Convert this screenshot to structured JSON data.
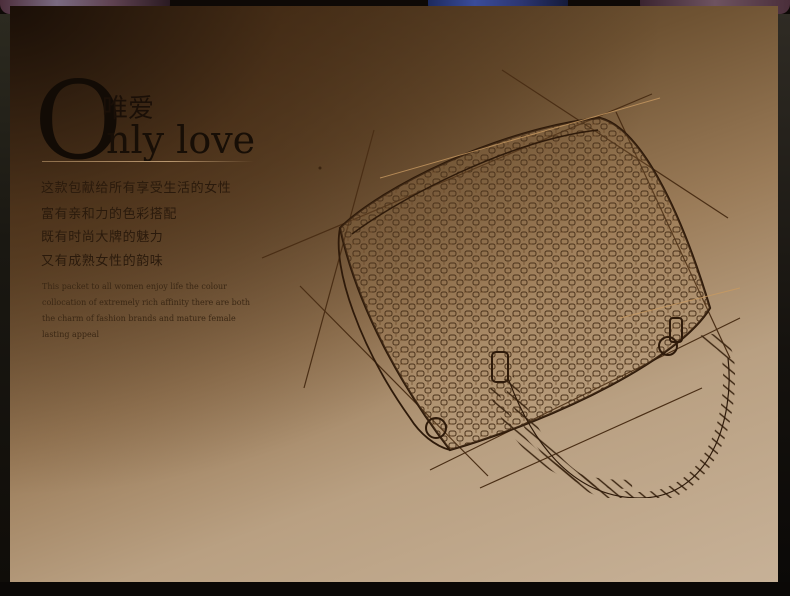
{
  "heading": {
    "big_letter": "O",
    "cn": "唯爱",
    "en": "nly love"
  },
  "copy_cn": [
    "这款包献给所有享受生活的女性",
    "富有亲和力的色彩搭配",
    "既有时尚大牌的魅力",
    "又有成熟女性的韵味"
  ],
  "copy_en": [
    "This packet to all women enjoy life the colour",
    "collocation of extremely rich affinity there are both",
    "the charm of fashion brands and mature female",
    "lasting appeal"
  ],
  "colors": {
    "panel_dark": "#3d2a15",
    "panel_light": "#c7b197",
    "sketch": "#3a2410",
    "guide": "#4a2e15",
    "accent": "#c89a62"
  },
  "illustration": "handbag-sketch"
}
